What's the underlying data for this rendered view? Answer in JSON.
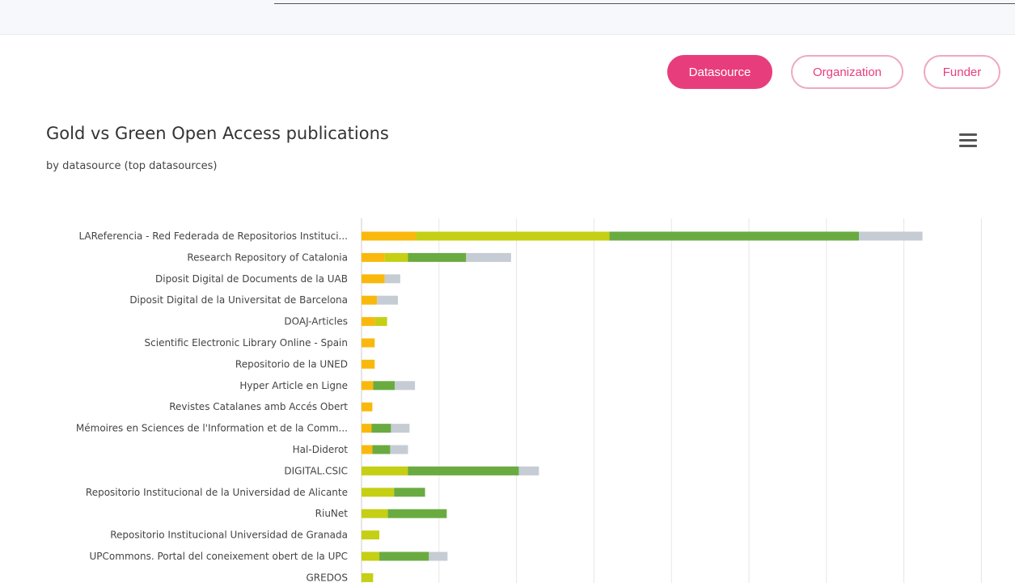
{
  "filters": [
    {
      "label": "Datasource",
      "active": true
    },
    {
      "label": "Organization",
      "active": false
    },
    {
      "label": "Funder",
      "active": false
    }
  ],
  "menu_icon": "hamburger-menu-icon",
  "colors": {
    "accent": "#e83d7c",
    "series": [
      "#f9b90c",
      "#c5cf14",
      "#6aab41",
      "#c6ccd4"
    ]
  },
  "chart_data": {
    "type": "bar",
    "orientation": "horizontal",
    "stacked": true,
    "title": "Gold vs Green Open Access publications",
    "subtitle": "by datasource (top datasources)",
    "legend": "none visible",
    "grid": true,
    "categories": [
      "LAReferencia - Red Federada de Repositorios Instituci...",
      "Research Repository of Catalonia",
      "Diposit Digital de Documents de la UAB",
      "Diposit Digital de la Universitat de Barcelona",
      "DOAJ-Articles",
      "Scientific Electronic Library Online - Spain",
      "Repositorio de la UNED",
      "Hyper Article en Ligne",
      "Revistes Catalanes amb Accés Obert",
      "Mémoires en Sciences de l'Information et de la Comm...",
      "Hal-Diderot",
      "DIGITAL.CSIC",
      "Repositorio Institucional de la Universidad de Alicante",
      "RiuNet",
      "Repositorio Institucional Universidad de Granada",
      "UPCommons. Portal del coneixement obert de la UPC",
      "GREDOS"
    ],
    "series": [
      {
        "values": [
          70,
          30,
          30,
          20,
          17,
          17,
          17,
          15,
          14,
          13,
          14,
          0,
          0,
          0,
          0,
          0,
          0
        ],
        "color": "#f9b90c"
      },
      {
        "values": [
          250,
          30,
          0,
          0,
          16,
          0,
          0,
          0,
          0,
          0,
          0,
          60,
          42,
          34,
          23,
          23,
          15
        ],
        "color": "#c5cf14"
      },
      {
        "values": [
          322,
          75,
          0,
          0,
          0,
          0,
          0,
          28,
          0,
          25,
          23,
          143,
          40,
          76,
          0,
          64,
          0
        ],
        "color": "#6aab41"
      },
      {
        "values": [
          82,
          58,
          20,
          27,
          0,
          0,
          0,
          26,
          0,
          24,
          23,
          26,
          0,
          0,
          0,
          24,
          0
        ],
        "color": "#c6ccd4"
      }
    ],
    "xlim": [
      0,
      800
    ],
    "x_gridlines": [
      0,
      100,
      200,
      300,
      400,
      500,
      600,
      700,
      800
    ]
  }
}
